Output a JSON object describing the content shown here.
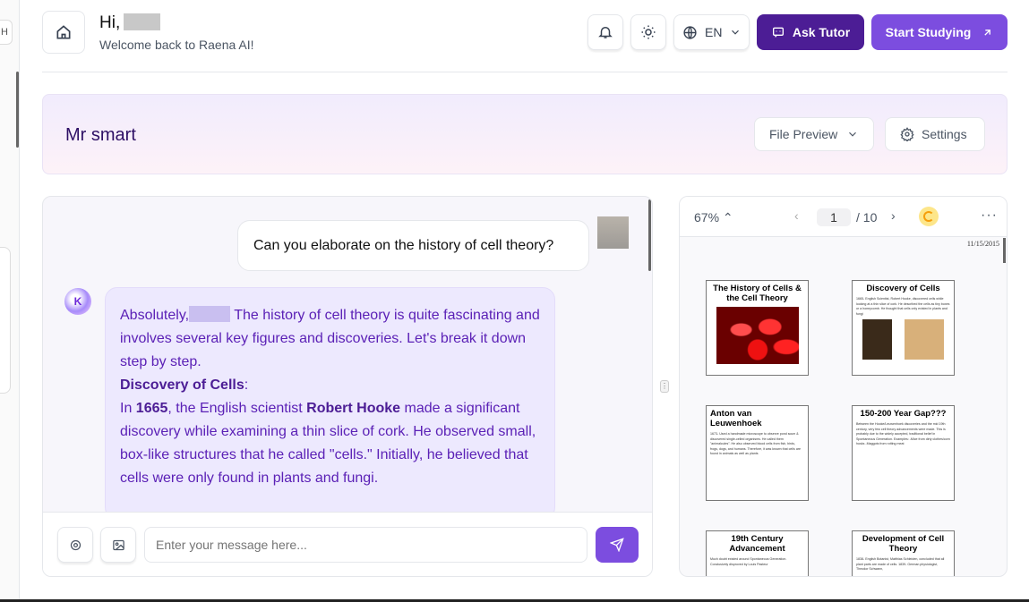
{
  "header": {
    "greeting": "Hi,",
    "welcome": "Welcome back to Raena AI!",
    "language": "EN",
    "ask_tutor": "Ask Tutor",
    "start_studying": "Start Studying"
  },
  "leftstrip": {
    "tab_label": "H"
  },
  "banner": {
    "title": "Mr smart",
    "file_preview": "File Preview",
    "settings": "Settings"
  },
  "chat": {
    "user_message": "Can you elaborate on the history of cell theory?",
    "bot": {
      "p1a": "Absolutely,",
      "p1b": " The history of cell theory is quite fascinating and involves several key figures and discoveries. Let's break it down step by step.",
      "heading": "Discovery of Cells",
      "colon": ":",
      "p2a": "In ",
      "year": "1665",
      "p2b": ", the English scientist ",
      "name": "Robert Hooke",
      "p2c": " made a significant discovery while examining a thin slice of cork. He observed small, box-like structures that he called \"cells.\" Initially, he believed that cells were only found in plants and fungi."
    },
    "input_placeholder": "Enter your message here..."
  },
  "pdf": {
    "zoom": "67%",
    "page": "1",
    "total": "/ 10",
    "date": "11/15/2015",
    "slides": [
      {
        "title": "The History of Cells & the Cell Theory",
        "body": ""
      },
      {
        "title": "Discovery of Cells",
        "body": "1665- English Scientist, Robert Hooke, discovered cells while looking at a thin slice of cork. He described the cells as tiny boxes or a honeycomb. He thought that cells only existed in plants and fungi"
      },
      {
        "title": "Anton van Leuwenhoek",
        "body": "1673- Used a handmade microscope to observe pond scum & discovered single-celled organisms. He called them \"animalcules\". He also observed blood cells from fish, birds, frogs, dogs, and humans. Therefore, it was known that cells are found in animals as well as plants"
      },
      {
        "title": "150-200 Year Gap???",
        "body": "Between the Hooke/Leuwenhoek discoveries and the mid 19th century, very few cell theory advancements were made. This is probably due to the widely accepted, traditional belief in Spontaneous Generation. Examples: -Mice from dirty clothes/corn husks -Maggots from rotting meat"
      },
      {
        "title": "19th Century Advancement",
        "body": "Much doubt existed around Spontaneous Generation. Conclusively disproved by Louis Pasteur"
      },
      {
        "title": "Development of Cell Theory",
        "body": "1838- English Botanist, Matthias Schleiden, concluded that all plant parts are made of cells. 1839- German physiologist, Theodor Schwann,"
      }
    ]
  },
  "colors": {
    "primary": "#7c4ddf",
    "dark": "#4c1d95"
  }
}
